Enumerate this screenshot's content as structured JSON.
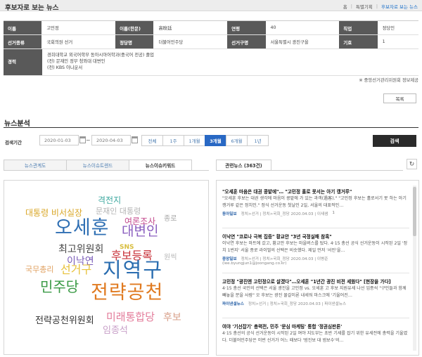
{
  "header": {
    "title": "후보자로 보는 뉴스",
    "breadcrumb": [
      "홈",
      "특별기획",
      "후보자로 보는 뉴스"
    ]
  },
  "candidate": {
    "labels": {
      "name": "이름",
      "name_hanja": "이름(한문)",
      "age": "연령",
      "job": "직업",
      "category": "선거종류",
      "party": "정당명",
      "district": "선거구명",
      "number": "기호",
      "career": "경력"
    },
    "values": {
      "name": "고민정",
      "name_hanja": "高旼廷",
      "age": "40",
      "job": "정당인",
      "category": "국회의원 선거",
      "party": "더불어민주당",
      "district": "서울특별시 광진구을",
      "number": "1",
      "career": [
        "경희대학교 외국어학부 동아시아어학과(중국어 전공) 졸업",
        "(전) 문재인 정부 청와대 대변인",
        "(전) KBS 아나운서"
      ]
    },
    "source": "※ 중앙선거관리위원회 정보제공",
    "list_button": "목록"
  },
  "news_analysis": {
    "title": "뉴스분석",
    "period_label": "검색기간",
    "date_from": "2020-01-03",
    "date_to": "2020-04-03",
    "tilde": "~",
    "periods": [
      "전체",
      "1주",
      "1개월",
      "3개월",
      "6개월",
      "1년"
    ],
    "selected_period": "3개월",
    "search_button": "검색",
    "tabs": [
      "뉴스관계도",
      "뉴스이슈트렌드",
      "뉴스이슈키워드"
    ],
    "active_tab": "뉴스이슈키워드",
    "related_tab": "관련뉴스 (363건)",
    "refresh_icon": "refresh-icon"
  },
  "word_cloud": [
    {
      "text": "격전지",
      "color": "#3fa9a0"
    },
    {
      "text": "대통령 비서실장",
      "color": "#d9a728"
    },
    {
      "text": "문재인 대통령",
      "color": "#b5b5b5"
    },
    {
      "text": "오세훈",
      "color": "#2f6fb3"
    },
    {
      "text": "여론조사",
      "color": "#c44b8e"
    },
    {
      "text": "종로",
      "color": "#a8a8a8"
    },
    {
      "text": "대변인",
      "color": "#8b5fbf"
    },
    {
      "text": "최고위원회",
      "color": "#444444"
    },
    {
      "text": "SNS",
      "color": "#d8bd3d"
    },
    {
      "text": "후보등록",
      "color": "#c8323a"
    },
    {
      "text": "이낙연",
      "color": "#7a5cb8"
    },
    {
      "text": "원씩",
      "color": "#b8b8b8"
    },
    {
      "text": "국무총리",
      "color": "#e0a060"
    },
    {
      "text": "선거구",
      "color": "#e8c23a"
    },
    {
      "text": "지역구",
      "color": "#2a6db0"
    },
    {
      "text": "민주당",
      "color": "#3a9a45"
    },
    {
      "text": "전략공천",
      "color": "#e07a20"
    },
    {
      "text": "미래통합당",
      "color": "#e37b9a"
    },
    {
      "text": "후보",
      "color": "#d9a28c"
    },
    {
      "text": "전략공천위원회",
      "color": "#333333"
    },
    {
      "text": "임종석",
      "color": "#c8a0c8"
    }
  ],
  "related_news": [
    {
      "title": "\"오세훈 마음은 대권 콩밭에\"… \"고민정 홀로 못서는 아기 캥거루\"",
      "summary": "\"오세훈 후보는 대권 생각에 마음이 콩밭에 가 있는 과객(過客).\" \"고민정 후보는 홀로서기 못 하는 아기 캥거루 같은 정치인.\" 정식 선거운동 첫날인 2일, 서울의 대표적인…",
      "press": "동아일보",
      "category": "정치>선거 | 정치>국회_정당 2020.04.03 | 이새샘",
      "num": "1"
    },
    {
      "title": "이낙연 \"코로나 극복 집중\" 황교안 \"3년 국정실패 참혹\"",
      "summary": "이낙연 후보는 마트에 갔고, 황교안 후보는 마을버스를 탔다. 4·15 총선 공식 선거운동이 시작된 2일 '정치 1번지' 서울 종로 라이벌의 선택은 비슷했다. 제일 먼저 '서민'을…",
      "press": "중앙일보",
      "category": "정치>선거 | 정치>국회_정당 2020.04.03 | 이병준",
      "email": "(lee.byungjun1@joongang.co.kr)",
      "num": ""
    },
    {
      "title": "고민정 \"광진엔 고민정으로 살겠다\"…오세훈 \"1년간 광진 비전 세웠다\" [현장을 가다]",
      "summary": "4·15 총선 국민의 선택은 서울 광진을 고민정 vs. 오세훈 고 후보 지원유세 나선 임종석 \"구민들과 함께 빼놓을 분을 사람\" 오 후보는 광진 물갈이론 내세워 마스크에 '기울어진…",
      "press": "파이낸셜뉴스",
      "category": "정치>선거 | 정치>국회_정당 2020.04.03 | 파이낸셜뉴스",
      "num": ""
    },
    {
      "title": "여야 '기선잡기' 총력전, 민주 '문심 마케팅' 통합 '정권심판론'",
      "summary": "4·15 총선의 공식 선거운동이 시작된 2일 여야 지도부는 초반 기세를 잡기 위한 유세전에 총력을 기울였다. 더불어민주당은 이번 선거가 어느 때보다 '범진보 대 범보수'의…",
      "press": "",
      "category": "",
      "num": ""
    }
  ]
}
